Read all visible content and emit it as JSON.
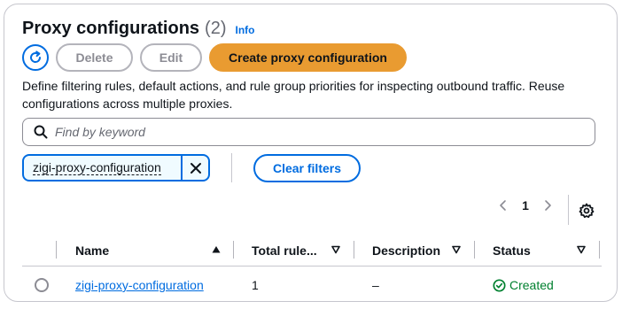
{
  "header": {
    "title": "Proxy configurations",
    "count": "(2)",
    "info_label": "Info"
  },
  "actions": {
    "refresh_icon": "refresh-icon",
    "delete_label": "Delete",
    "edit_label": "Edit",
    "create_label": "Create proxy configuration"
  },
  "description": "Define filtering rules, default actions, and rule group priorities for inspecting outbound traffic. Reuse configurations across multiple proxies.",
  "search": {
    "placeholder": "Find by keyword",
    "value": ""
  },
  "filter": {
    "token_label": "zigi-proxy-configuration",
    "clear_label": "Clear filters"
  },
  "pagination": {
    "current_page": "1"
  },
  "table": {
    "columns": [
      {
        "label": "Name"
      },
      {
        "label": "Total rule..."
      },
      {
        "label": "Description"
      },
      {
        "label": "Status"
      }
    ],
    "rows": [
      {
        "name": "zigi-proxy-configuration",
        "total_rules": "1",
        "description": "–",
        "status": "Created"
      }
    ]
  },
  "colors": {
    "accent": "#006ce0",
    "primary_button": "#e99b31",
    "success": "#00802f",
    "border": "#c6c6cd"
  }
}
